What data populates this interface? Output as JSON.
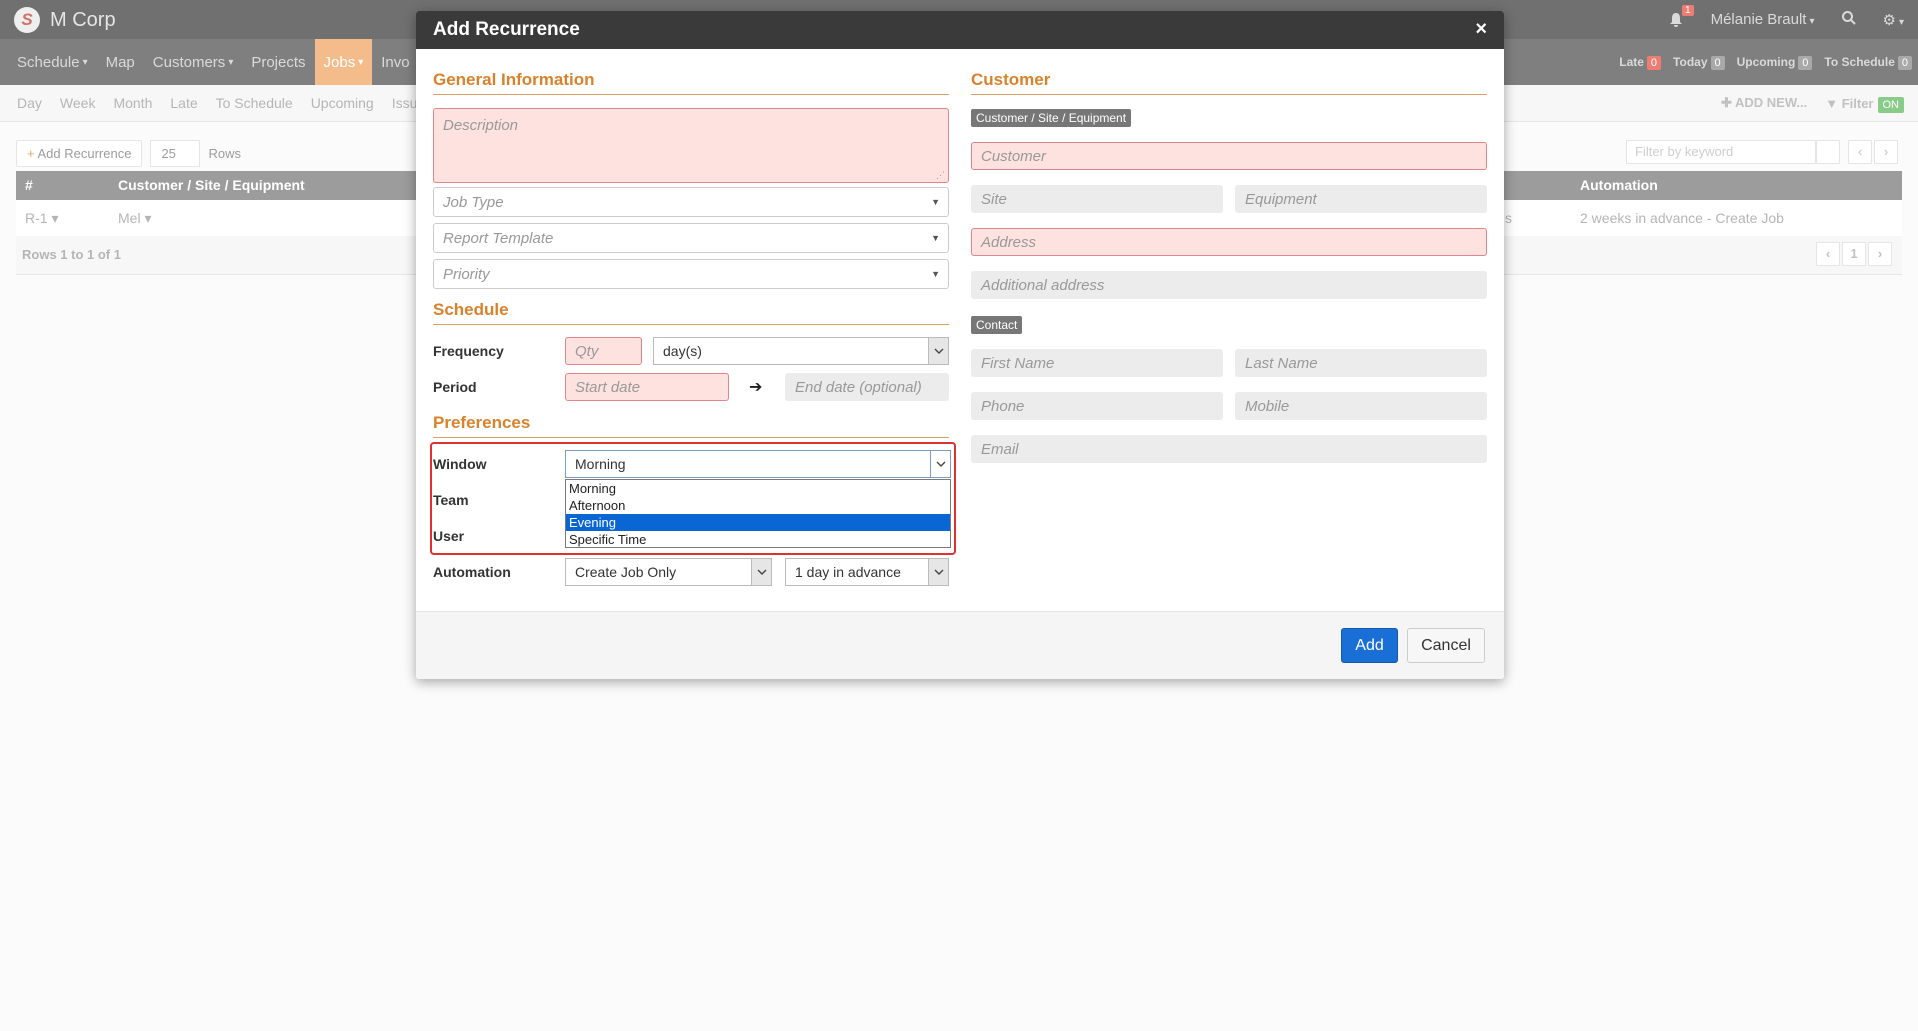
{
  "app": {
    "brand": "M Corp",
    "user_name": "Mélanie Brault",
    "notification_count": "1"
  },
  "nav": {
    "items": [
      "Schedule",
      "Map",
      "Customers",
      "Projects",
      "Jobs",
      "Invo"
    ],
    "active": "Jobs",
    "right": [
      {
        "label": "Late",
        "count": "0"
      },
      {
        "label": "Today",
        "count": "0"
      },
      {
        "label": "Upcoming",
        "count": "0"
      },
      {
        "label": "To Schedule",
        "count": "0"
      }
    ]
  },
  "subnav": {
    "items": [
      "Day",
      "Week",
      "Month",
      "Late",
      "To Schedule",
      "Upcoming",
      "Issu"
    ],
    "add_new": "ADD NEW...",
    "filter": "Filter",
    "filter_state": "ON"
  },
  "toolbar": {
    "add_recurrence": "Add Recurrence",
    "rows_value": "25",
    "rows_label": "Rows",
    "filter_placeholder": "Filter by keyword",
    "page": "1"
  },
  "grid": {
    "headers": [
      "#",
      "Customer / Site / Equipment",
      "Automation"
    ],
    "row": {
      "id": "R-1",
      "customer": "Mel",
      "tail": "s",
      "automation": "2 weeks in advance - Create Job"
    },
    "rows_info": "Rows 1 to 1 of 1"
  },
  "modal": {
    "title": "Add Recurrence",
    "close": "×",
    "general": {
      "title": "General Information",
      "description_ph": "Description",
      "job_type_ph": "Job Type",
      "report_template_ph": "Report Template",
      "priority_ph": "Priority"
    },
    "schedule": {
      "title": "Schedule",
      "frequency_label": "Frequency",
      "qty_ph": "Qty",
      "unit_value": "day(s)",
      "period_label": "Period",
      "start_ph": "Start date",
      "end_ph": "End date (optional)"
    },
    "preferences": {
      "title": "Preferences",
      "window_label": "Window",
      "window_value": "Morning",
      "window_options": [
        "Morning",
        "Afternoon",
        "Evening",
        "Specific Time"
      ],
      "window_highlighted": "Evening",
      "team_label": "Team",
      "user_label": "User",
      "automation_label": "Automation",
      "automation_value": "Create Job Only",
      "advance_value": "1 day in advance"
    },
    "customer": {
      "title": "Customer",
      "tag": "Customer / Site / Equipment",
      "customer_ph": "Customer",
      "site_ph": "Site",
      "equipment_ph": "Equipment",
      "address_ph": "Address",
      "additional_address_ph": "Additional address",
      "contact_tag": "Contact",
      "first_name_ph": "First Name",
      "last_name_ph": "Last Name",
      "phone_ph": "Phone",
      "mobile_ph": "Mobile",
      "email_ph": "Email"
    },
    "footer": {
      "add": "Add",
      "cancel": "Cancel"
    }
  },
  "colors": {
    "accent_orange": "#d9822b",
    "primary_blue": "#1a6fd6",
    "required_pink": "#fde2df",
    "highlight_red": "#e03030"
  }
}
